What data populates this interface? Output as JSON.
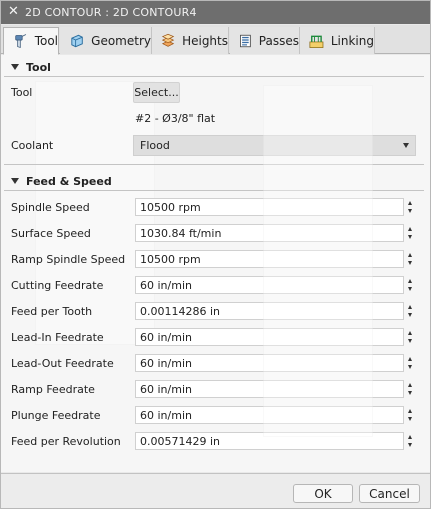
{
  "window": {
    "title": "2D CONTOUR : 2D CONTOUR4",
    "close_glyph": "✕"
  },
  "tabs": [
    {
      "label": "Tool",
      "icon": "tool-icon"
    },
    {
      "label": "Geometry",
      "icon": "geometry-icon"
    },
    {
      "label": "Heights",
      "icon": "heights-icon"
    },
    {
      "label": "Passes",
      "icon": "passes-icon"
    },
    {
      "label": "Linking",
      "icon": "linking-icon"
    }
  ],
  "tool_section": {
    "heading": "Tool",
    "tool_label": "Tool",
    "select_button": "Select...",
    "tool_description": "#2 - Ø3/8\" flat",
    "coolant_label": "Coolant",
    "coolant_value": "Flood"
  },
  "feed_section": {
    "heading": "Feed & Speed",
    "rows": [
      {
        "label": "Spindle Speed",
        "value": "10500 rpm"
      },
      {
        "label": "Surface Speed",
        "value": "1030.84 ft/min"
      },
      {
        "label": "Ramp Spindle Speed",
        "value": "10500 rpm"
      },
      {
        "label": "Cutting Feedrate",
        "value": "60 in/min"
      },
      {
        "label": "Feed per Tooth",
        "value": "0.00114286 in"
      },
      {
        "label": "Lead-In Feedrate",
        "value": "60 in/min"
      },
      {
        "label": "Lead-Out Feedrate",
        "value": "60 in/min"
      },
      {
        "label": "Ramp Feedrate",
        "value": "60 in/min"
      },
      {
        "label": "Plunge Feedrate",
        "value": "60 in/min"
      },
      {
        "label": "Feed per Revolution",
        "value": "0.00571429 in"
      }
    ]
  },
  "footer": {
    "ok_label": "OK",
    "cancel_label": "Cancel"
  },
  "colors": {
    "titlebar": "#6e6e6e",
    "panel": "#f6f6f6",
    "field": "#ffffff"
  }
}
